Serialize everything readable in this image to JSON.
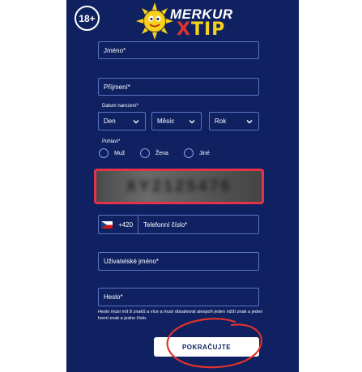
{
  "header": {
    "age_badge": "18+",
    "logo_top": "MERKUR",
    "logo_bottom_x": "X",
    "logo_bottom_rest": "TIP"
  },
  "form": {
    "first_name": "Jméno*",
    "last_name": "Příjmení*",
    "birthdate_label": "Datum narození*",
    "day": "Den",
    "month": "Měsíc",
    "year": "Rok",
    "gender_label": "Pohlaví*",
    "gender_options": [
      "Muž",
      "Žena",
      "Jiné"
    ],
    "captcha_text": "XY2125476",
    "phone_prefix": "+420",
    "phone_label": "Telefonní číslo*",
    "username": "Uživatelské jméno*",
    "password": "Heslo*",
    "password_hint": "Heslo musí mít 8 znaků a více a musí obsahovat alespoň jeden nižší znak a jeden horní znak a jedno číslo.",
    "submit": "POKRAČUJTE"
  },
  "colors": {
    "panel_bg": "#0f2161",
    "field_border": "#5c73c2",
    "captcha_highlight": "#e23349",
    "annotation_red": "#e0322c",
    "logo_yellow": "#f6d21a"
  },
  "icons": {
    "select_chevron": "chevron-down-icon",
    "phone_country": "czech-flag-icon"
  }
}
